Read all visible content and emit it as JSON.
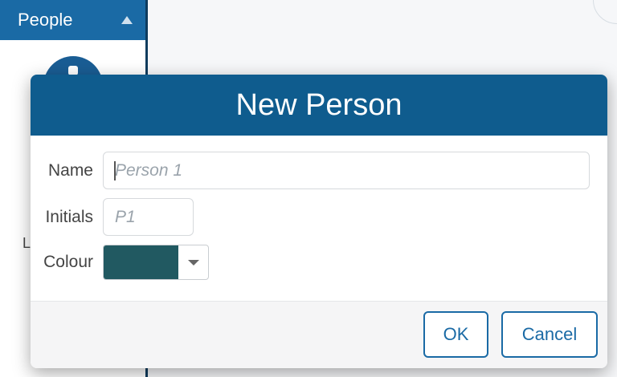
{
  "sidebar": {
    "header_label": "People",
    "cut_letter": "L",
    "header_color": "#1a6aa5"
  },
  "dialog": {
    "title": "New Person",
    "name": {
      "label": "Name",
      "value": "",
      "placeholder": "Person 1"
    },
    "initials": {
      "label": "Initials",
      "value": "",
      "placeholder": "P1"
    },
    "colour": {
      "label": "Colour",
      "selected_color": "#215961"
    },
    "buttons": {
      "ok": "OK",
      "cancel": "Cancel"
    }
  },
  "colors": {
    "dialog_header": "#0f5c8e",
    "button_border": "#1a6aa5"
  },
  "icons": {
    "sidebar_caret": "caret-up-icon",
    "colour_dropdown": "chevron-down-icon"
  }
}
